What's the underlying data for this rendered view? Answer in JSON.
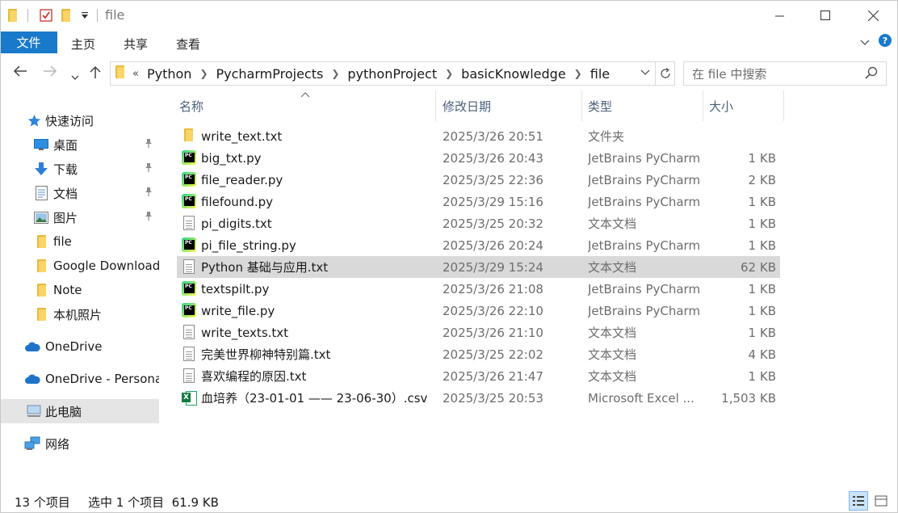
{
  "titlebar": {
    "title": "file",
    "qa_save_icon": "properties-checkmark-icon",
    "qa_customize_icon": "chevron-down-icon"
  },
  "window_controls": {
    "minimize": "—",
    "maximize": "☐",
    "close": "✕"
  },
  "ribbon": {
    "tabs": [
      {
        "label": "文件",
        "active": true
      },
      {
        "label": "主页"
      },
      {
        "label": "共享"
      },
      {
        "label": "查看"
      }
    ],
    "expand_icon": "chevron-down-icon",
    "help_icon": "help-icon",
    "help_glyph": "?"
  },
  "address_bar": {
    "overflow": "«",
    "crumbs": [
      "Python",
      "PycharmProjects",
      "pythonProject",
      "basicKnowledge",
      "file"
    ]
  },
  "search": {
    "placeholder": "在 file 中搜索"
  },
  "sidebar": {
    "items": [
      {
        "label": "快速访问",
        "icon": "star-icon"
      },
      {
        "label": "桌面",
        "icon": "desktop-icon",
        "pinned": true
      },
      {
        "label": "下载",
        "icon": "download-icon",
        "pinned": true
      },
      {
        "label": "文档",
        "icon": "document-icon",
        "pinned": true
      },
      {
        "label": "图片",
        "icon": "picture-icon",
        "pinned": true
      },
      {
        "label": "file",
        "icon": "folder-icon"
      },
      {
        "label": "Google Download",
        "icon": "folder-icon"
      },
      {
        "label": "Note",
        "icon": "folder-icon"
      },
      {
        "label": "本机照片",
        "icon": "folder-icon"
      },
      {
        "label": "OneDrive",
        "icon": "cloud-icon"
      },
      {
        "label": "OneDrive - Persona",
        "icon": "cloud-icon"
      },
      {
        "label": "此电脑",
        "icon": "computer-icon",
        "selected": true
      },
      {
        "label": "网络",
        "icon": "network-icon"
      }
    ]
  },
  "columns": {
    "name": "名称",
    "date": "修改日期",
    "type": "类型",
    "size": "大小"
  },
  "files": [
    {
      "name": "write_text.txt",
      "date": "2025/3/26 20:51",
      "type": "文件夹",
      "size": "",
      "icon": "folder"
    },
    {
      "name": "big_txt.py",
      "date": "2025/3/26 20:43",
      "type": "JetBrains PyCharm",
      "size": "1 KB",
      "icon": "pycharm"
    },
    {
      "name": "file_reader.py",
      "date": "2025/3/25 22:36",
      "type": "JetBrains PyCharm",
      "size": "2 KB",
      "icon": "pycharm"
    },
    {
      "name": "filefound.py",
      "date": "2025/3/29 15:16",
      "type": "JetBrains PyCharm",
      "size": "1 KB",
      "icon": "pycharm"
    },
    {
      "name": "pi_digits.txt",
      "date": "2025/3/25 20:32",
      "type": "文本文档",
      "size": "1 KB",
      "icon": "text"
    },
    {
      "name": "pi_file_string.py",
      "date": "2025/3/26 20:24",
      "type": "JetBrains PyCharm",
      "size": "1 KB",
      "icon": "pycharm"
    },
    {
      "name": "Python 基础与应用.txt",
      "date": "2025/3/29 15:24",
      "type": "文本文档",
      "size": "62 KB",
      "icon": "text",
      "selected": true
    },
    {
      "name": "textspilt.py",
      "date": "2025/3/26 21:08",
      "type": "JetBrains PyCharm",
      "size": "1 KB",
      "icon": "pycharm"
    },
    {
      "name": "write_file.py",
      "date": "2025/3/26 22:10",
      "type": "JetBrains PyCharm",
      "size": "1 KB",
      "icon": "pycharm"
    },
    {
      "name": "write_texts.txt",
      "date": "2025/3/26 21:10",
      "type": "文本文档",
      "size": "1 KB",
      "icon": "text"
    },
    {
      "name": "完美世界柳神特别篇.txt",
      "date": "2025/3/25 22:02",
      "type": "文本文档",
      "size": "4 KB",
      "icon": "text"
    },
    {
      "name": "喜欢编程的原因.txt",
      "date": "2025/3/26 21:47",
      "type": "文本文档",
      "size": "1 KB",
      "icon": "text"
    },
    {
      "name": "血培养（23-01-01 —— 23-06-30）.csv",
      "date": "2025/3/25 20:53",
      "type": "Microsoft Excel ...",
      "size": "1,503 KB",
      "icon": "excel"
    }
  ],
  "status": {
    "count": "13 个项目",
    "selection": "选中 1 个项目  61.9 KB"
  },
  "colors": {
    "accent": "#1979ca",
    "selected_row": "#d9d9d9",
    "header_text": "#4c607a"
  }
}
